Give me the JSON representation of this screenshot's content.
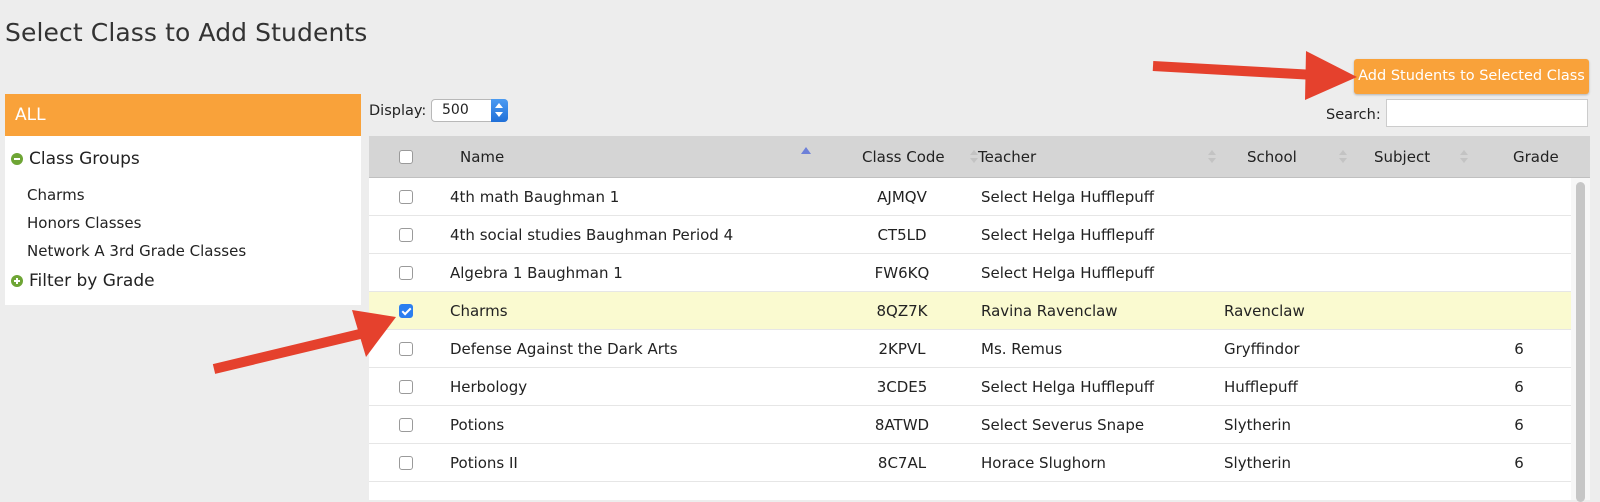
{
  "page": {
    "title": "Select Class to Add Students"
  },
  "sidebar": {
    "all_label": "ALL",
    "class_groups_label": "Class Groups",
    "items": [
      {
        "label": "Charms"
      },
      {
        "label": "Honors Classes"
      },
      {
        "label": "Network A 3rd Grade Classes"
      }
    ],
    "filter_by_grade_label": "Filter by Grade"
  },
  "toolbar": {
    "add_button_label": "Add Students to Selected Class",
    "search_label": "Search:",
    "search_value": "",
    "display_label": "Display:",
    "display_value": "500"
  },
  "table": {
    "columns": [
      "Name",
      "Class Code",
      "Teacher",
      "School",
      "Subject",
      "Grade"
    ],
    "sorted_column": "Name",
    "sort_direction": "ascending",
    "rows": [
      {
        "name": "4th math Baughman 1",
        "code": "AJMQV",
        "teacher": "Select Helga Hufflepuff",
        "school": "",
        "subject": "",
        "grade": "",
        "checked": false
      },
      {
        "name": "4th social studies Baughman Period 4",
        "code": "CT5LD",
        "teacher": "Select Helga Hufflepuff",
        "school": "",
        "subject": "",
        "grade": "",
        "checked": false
      },
      {
        "name": "Algebra 1 Baughman 1",
        "code": "FW6KQ",
        "teacher": "Select Helga Hufflepuff",
        "school": "",
        "subject": "",
        "grade": "",
        "checked": false
      },
      {
        "name": "Charms",
        "code": "8QZ7K",
        "teacher": "Ravina Ravenclaw",
        "school": "Ravenclaw",
        "subject": "",
        "grade": "",
        "checked": true
      },
      {
        "name": "Defense Against the Dark Arts",
        "code": "2KPVL",
        "teacher": "Ms. Remus",
        "school": "Gryffindor",
        "subject": "",
        "grade": "6",
        "checked": false
      },
      {
        "name": "Herbology",
        "code": "3CDE5",
        "teacher": "Select Helga Hufflepuff",
        "school": "Hufflepuff",
        "subject": "",
        "grade": "6",
        "checked": false
      },
      {
        "name": "Potions",
        "code": "8ATWD",
        "teacher": "Select Severus Snape",
        "school": "Slytherin",
        "subject": "",
        "grade": "6",
        "checked": false
      },
      {
        "name": "Potions II",
        "code": "8C7AL",
        "teacher": "Horace Slughorn",
        "school": "Slytherin",
        "subject": "",
        "grade": "6",
        "checked": false
      }
    ]
  },
  "colors": {
    "accent_orange": "#f9a23a",
    "annotation_red": "#e5412d",
    "selected_row": "#fafad0",
    "group_icon_green": "#6ea535"
  },
  "icons": {
    "class_groups": "minus-circle-icon",
    "filter_by_grade": "plus-circle-icon"
  }
}
